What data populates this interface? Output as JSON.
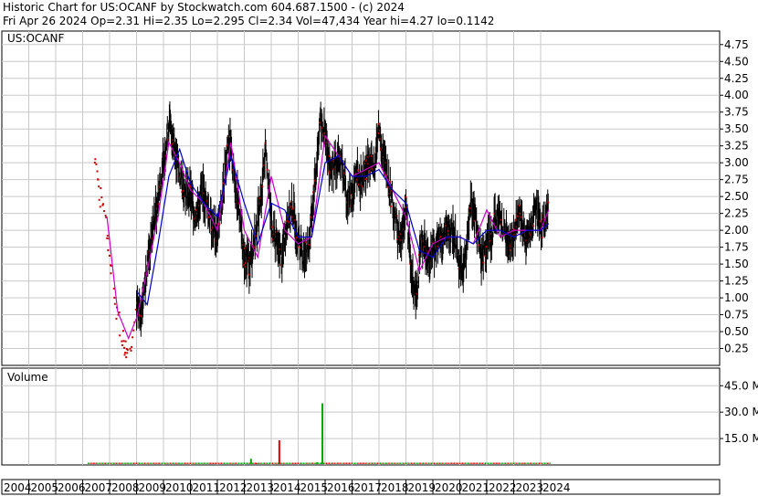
{
  "header": {
    "title": "Historic Chart for US:OCANF by Stockwatch.com 604.687.1500 - (c) 2024",
    "quote": "Fri Apr 26 2024   Op=2.31  Hi=2.35  Lo=2.295  Cl=2.34  Vol=47,434  Year hi=4.27  lo=0.1142"
  },
  "colors": {
    "price_bars": "#000000",
    "close_dots": "#cc0000",
    "ma_short": "#cc00cc",
    "ma_long": "#0000cc",
    "volume_up": "#00aa00",
    "volume_down": "#dd0000",
    "grid": "#c8c8c8",
    "background": "#ffffff"
  },
  "chart_data": [
    {
      "type": "line",
      "title": "US:OCANF",
      "grid": true,
      "y_axis_side": "right",
      "ylim": [
        0,
        4.95
      ],
      "y_ticks": [
        "0.25",
        "0.50",
        "0.75",
        "1.00",
        "1.25",
        "1.50",
        "1.75",
        "2.00",
        "2.25",
        "2.50",
        "2.75",
        "3.00",
        "3.25",
        "3.50",
        "3.75",
        "4.00",
        "4.25",
        "4.50",
        "4.75"
      ],
      "x_ticks": [
        "2004",
        "2005",
        "2006",
        "2007",
        "2008",
        "2009",
        "2010",
        "2011",
        "2012",
        "2013",
        "2014",
        "2015",
        "2016",
        "2017",
        "2018",
        "2019",
        "2020",
        "2021",
        "2022",
        "2023",
        "2024"
      ],
      "series": [
        {
          "type": "price_bars",
          "x": [
            2007.4,
            2007.6,
            2007.8,
            2008.0,
            2008.2,
            2008.4,
            2008.6,
            2008.8,
            2009.0,
            2009.2,
            2009.4,
            2009.6,
            2009.8,
            2010.0,
            2010.2,
            2010.4,
            2010.6,
            2010.8,
            2011.0,
            2011.2,
            2011.4,
            2011.6,
            2011.8,
            2012.0,
            2012.2,
            2012.4,
            2012.6,
            2012.8,
            2013.0,
            2013.2,
            2013.4,
            2013.6,
            2013.8,
            2014.0,
            2014.2,
            2014.4,
            2014.6,
            2014.8,
            2015.0,
            2015.2,
            2015.4,
            2015.6,
            2015.8,
            2016.0,
            2016.2,
            2016.4,
            2016.6,
            2016.8,
            2017.0,
            2017.2,
            2017.4,
            2017.6,
            2017.8,
            2018.0,
            2018.2,
            2018.4,
            2018.6,
            2018.8,
            2019.0,
            2019.2,
            2019.4,
            2019.6,
            2019.8,
            2020.0,
            2020.2,
            2020.4,
            2020.6,
            2020.8,
            2021.0,
            2021.2,
            2021.4,
            2021.6,
            2021.8,
            2022.0,
            2022.2,
            2022.4,
            2022.6,
            2022.8,
            2023.0,
            2023.2,
            2023.4,
            2023.6,
            2023.8,
            2024.0,
            2024.3
          ],
          "values": [
            3.2,
            2.5,
            2.3,
            1.5,
            0.9,
            0.5,
            0.2,
            0.4,
            0.8,
            0.9,
            1.5,
            2.0,
            2.5,
            3.0,
            3.6,
            3.3,
            2.8,
            2.6,
            2.5,
            2.2,
            2.6,
            2.4,
            2.1,
            1.9,
            2.5,
            3.4,
            2.9,
            2.3,
            1.6,
            1.5,
            1.9,
            2.4,
            3.3,
            2.1,
            1.8,
            1.6,
            2.2,
            2.3,
            1.9,
            1.6,
            1.8,
            2.6,
            3.6,
            3.4,
            2.9,
            3.0,
            3.0,
            2.5,
            2.5,
            2.8,
            2.7,
            3.0,
            2.9,
            3.5,
            3.0,
            2.6,
            2.2,
            1.8,
            2.4,
            1.3,
            1.1,
            1.9,
            1.6,
            1.7,
            1.8,
            1.9,
            2.0,
            1.9,
            1.5,
            1.5,
            2.5,
            2.1,
            1.6,
            1.8,
            2.0,
            2.2,
            2.1,
            1.8,
            1.9,
            2.3,
            1.9,
            1.9,
            2.3,
            2.0,
            2.34
          ]
        },
        {
          "name": "",
          "type": "moving_average_short",
          "x": [
            2007.9,
            2008.3,
            2008.7,
            2009.0,
            2009.4,
            2009.8,
            2010.2,
            2010.6,
            2011.0,
            2011.5,
            2012.0,
            2012.5,
            2013.0,
            2013.5,
            2014.0,
            2014.5,
            2015.0,
            2015.5,
            2016.0,
            2016.5,
            2017.0,
            2017.5,
            2018.0,
            2018.5,
            2019.0,
            2019.5,
            2020.0,
            2020.5,
            2021.0,
            2021.5,
            2022.0,
            2022.5,
            2023.0,
            2023.5,
            2024.0,
            2024.3
          ],
          "values": [
            2.2,
            0.8,
            0.4,
            0.7,
            1.4,
            2.2,
            3.3,
            3.0,
            2.6,
            2.4,
            2.0,
            3.3,
            2.0,
            1.6,
            2.8,
            2.0,
            1.8,
            1.9,
            3.4,
            3.1,
            2.8,
            2.9,
            3.0,
            2.6,
            2.2,
            1.4,
            1.8,
            1.9,
            1.9,
            1.8,
            2.3,
            1.9,
            2.0,
            2.0,
            2.0,
            2.3
          ]
        },
        {
          "name": "",
          "type": "moving_average_long",
          "x": [
            2009.0,
            2009.4,
            2009.8,
            2010.2,
            2010.6,
            2011.0,
            2011.5,
            2012.0,
            2012.5,
            2013.0,
            2013.5,
            2014.0,
            2014.5,
            2015.0,
            2015.5,
            2016.0,
            2016.5,
            2017.0,
            2017.5,
            2018.0,
            2018.5,
            2019.0,
            2019.5,
            2020.0,
            2020.5,
            2021.0,
            2021.5,
            2022.0,
            2022.5,
            2023.0,
            2023.5,
            2024.0,
            2024.3
          ],
          "values": [
            1.1,
            0.9,
            1.8,
            2.8,
            3.2,
            2.7,
            2.4,
            2.2,
            3.1,
            2.4,
            1.8,
            2.4,
            2.3,
            1.9,
            1.9,
            3.0,
            3.1,
            2.8,
            2.8,
            2.9,
            2.6,
            2.4,
            1.7,
            1.6,
            1.9,
            1.9,
            1.8,
            2.0,
            2.0,
            1.9,
            2.0,
            2.0,
            2.1
          ]
        }
      ]
    },
    {
      "type": "bar",
      "title": "Volume",
      "grid": true,
      "y_axis_side": "right",
      "ylim": [
        0,
        55
      ],
      "y_ticks": [
        "15.0 M",
        "30.0 M",
        "45.0 M"
      ],
      "bars": [
        {
          "x": 2013.25,
          "value": 3.5,
          "dir": "up"
        },
        {
          "x": 2013.45,
          "value": 1.0,
          "dir": "down"
        },
        {
          "x": 2014.3,
          "value": 14.0,
          "dir": "down"
        },
        {
          "x": 2015.7,
          "value": 1.5,
          "dir": "up"
        },
        {
          "x": 2015.9,
          "value": 35.0,
          "dir": "up"
        },
        {
          "x": 2020.3,
          "value": 0.6,
          "dir": "down"
        },
        {
          "x": 2023.4,
          "value": 0.8,
          "dir": "up"
        }
      ]
    }
  ]
}
